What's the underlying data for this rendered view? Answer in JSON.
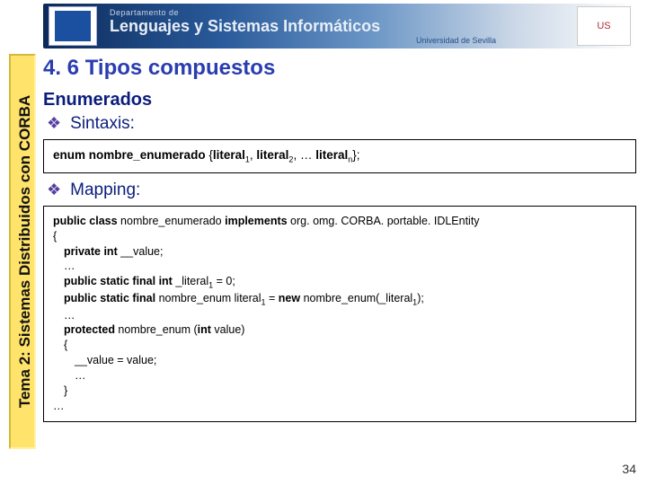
{
  "banner": {
    "dept": "Departamento de",
    "main": "Lenguajes y Sistemas Informáticos",
    "uni": "Universidad de Sevilla",
    "shield": "US"
  },
  "sidebar": {
    "label": "Tema 2: Sistemas Distribuidos con CORBA"
  },
  "title": "4. 6 Tipos compuestos",
  "subtitle": "Enumerados",
  "bullets": {
    "syntax": "Sintaxis:",
    "mapping": "Mapping:"
  },
  "syntaxBox": {
    "kw_enum": "enum",
    "name": "nombre_enumerado",
    "open": " {",
    "lit": "literal",
    "sep": ", ",
    "ellip": ", … ",
    "close": "};"
  },
  "mapBox": {
    "l1a": "public class",
    "l1b": "nombre_enumerado",
    "l1c": "implements",
    "l1d": " org. omg. CORBA. portable. IDLEntity",
    "l2": "{",
    "l3a": "private int",
    "l3b": " __value;",
    "l4": "…",
    "l5a": "public static final int",
    "l5b": " _literal",
    "l5c": " = 0;",
    "l6a": "public static final",
    "l6b": " nombre_enum literal",
    "l6c": " = ",
    "l6d": "new",
    "l6e": " nombre_enum(_literal",
    "l6f": ");",
    "l7": "…",
    "l8a": "protected",
    "l8b": " nombre_enum (",
    "l8c": "int",
    "l8d": " value)",
    "l9": "{",
    "l10": "__value = value;",
    "l11": "…",
    "l12": "}",
    "l13": "…"
  },
  "page": "34"
}
